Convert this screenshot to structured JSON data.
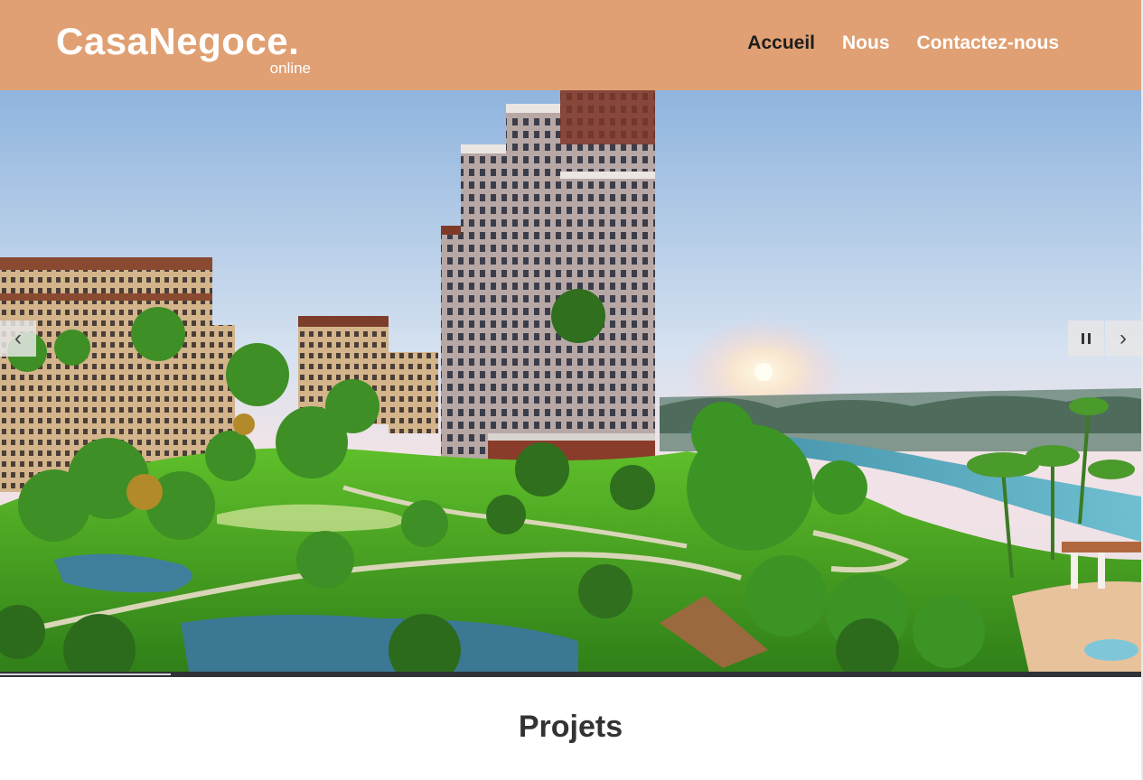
{
  "header": {
    "logo_title": "CasaNegoce.",
    "logo_subtitle": "online",
    "nav": [
      {
        "label": "Accueil",
        "active": true
      },
      {
        "label": "Nous",
        "active": false
      },
      {
        "label": "Contactez-nous",
        "active": false
      }
    ],
    "background_color": "#e0a073"
  },
  "slider": {
    "prev_icon": "chevron-left-icon",
    "pause_icon": "pause-icon",
    "next_icon": "chevron-right-icon",
    "prev_glyph": "‹",
    "next_glyph": "›",
    "progress": 0.15
  },
  "main": {
    "section_title": "Projets"
  }
}
